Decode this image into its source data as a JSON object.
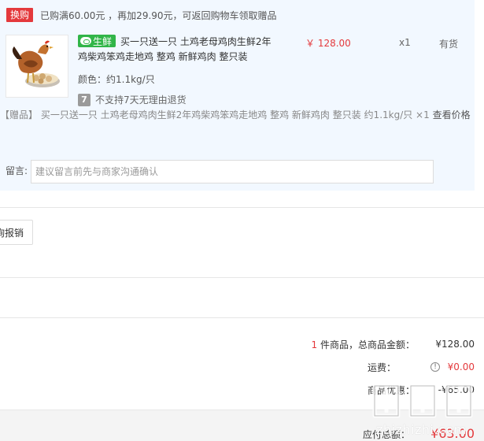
{
  "promo": {
    "badge": "换购",
    "text": "已购满60.00元 ，再加29.90元，可返回购物车领取赠品"
  },
  "product": {
    "fresh_tag": "生鲜",
    "title": "买一只送一只 土鸡老母鸡肉生鲜2年鸡柴鸡笨鸡走地鸡 整鸡 新鲜鸡肉 整只装",
    "attr": "颜色：约1.1kg/只",
    "return_policy": "不支持7天无理由退货",
    "return_icon": "7",
    "price": "￥ 128.00",
    "qty": "x1",
    "stock": "有货"
  },
  "gift": {
    "tag": "【赠品】",
    "text": "买一只送一只 土鸡老母鸡肉生鲜2年鸡柴鸡笨鸡走地鸡 整鸡 新鲜鸡肉 整只装 约1.1kg/只 ×1",
    "link": "查看价格"
  },
  "message": {
    "label": "留言:",
    "placeholder": "建议留言前先与商家沟通确认"
  },
  "invoice": {
    "button": "询报销"
  },
  "summary": {
    "count": "1",
    "count_suffix": "件商品，总商品金额：",
    "total": "¥128.00",
    "shipping_label": "运费：",
    "shipping_icon": "!",
    "shipping": "¥0.00",
    "discount_label": "商品优惠：",
    "discount": "-¥65.00",
    "payable_label": "应付总额：",
    "payable": "¥63.00"
  },
  "watermark": {
    "text": "zhizhizhi.com",
    "icon": "zhizhizhi-logo-icon"
  },
  "colors": {
    "accent_red": "#e4393c",
    "fresh_green": "#31b548",
    "panel_bg": "#f2f8ff"
  }
}
